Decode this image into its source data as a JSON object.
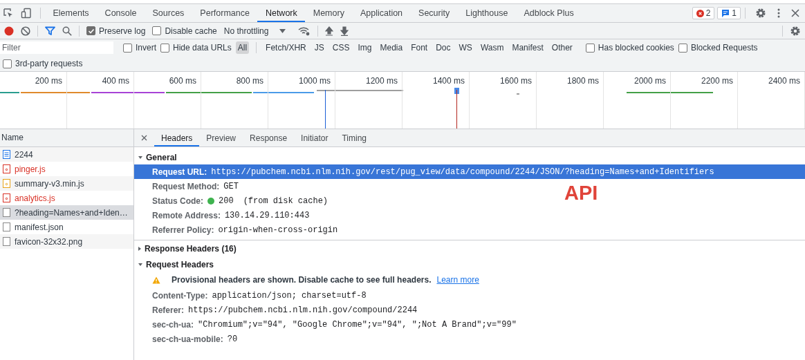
{
  "tabs": [
    {
      "label": "Elements",
      "selected": false
    },
    {
      "label": "Console",
      "selected": false
    },
    {
      "label": "Sources",
      "selected": false
    },
    {
      "label": "Performance",
      "selected": false
    },
    {
      "label": "Network",
      "selected": true
    },
    {
      "label": "Memory",
      "selected": false
    },
    {
      "label": "Application",
      "selected": false
    },
    {
      "label": "Security",
      "selected": false
    },
    {
      "label": "Lighthouse",
      "selected": false
    },
    {
      "label": "Adblock Plus",
      "selected": false
    }
  ],
  "badges": {
    "errors": "2",
    "messages": "1"
  },
  "toolbar": {
    "recording": true,
    "preserve_log": {
      "label": "Preserve log",
      "checked": true
    },
    "disable_cache": {
      "label": "Disable cache",
      "checked": false
    },
    "throttling": "No throttling"
  },
  "filter_bar": {
    "placeholder": "Filter",
    "options": [
      {
        "label": "Invert",
        "checked": false
      },
      {
        "label": "Hide data URLs",
        "checked": false
      }
    ],
    "types": [
      {
        "label": "All",
        "selected": true
      },
      {
        "label": "Fetch/XHR",
        "selected": false
      },
      {
        "label": "JS",
        "selected": false
      },
      {
        "label": "CSS",
        "selected": false
      },
      {
        "label": "Img",
        "selected": false
      },
      {
        "label": "Media",
        "selected": false
      },
      {
        "label": "Font",
        "selected": false
      },
      {
        "label": "Doc",
        "selected": false
      },
      {
        "label": "WS",
        "selected": false
      },
      {
        "label": "Wasm",
        "selected": false
      },
      {
        "label": "Manifest",
        "selected": false
      },
      {
        "label": "Other",
        "selected": false
      }
    ],
    "blocked": [
      {
        "label": "Has blocked cookies",
        "checked": false
      },
      {
        "label": "Blocked Requests",
        "checked": false
      }
    ],
    "third_party": {
      "label": "3rd-party requests",
      "checked": false
    }
  },
  "timeline": {
    "ticks": [
      "200 ms",
      "400 ms",
      "600 ms",
      "800 ms",
      "1000 ms",
      "1200 ms",
      "1400 ms",
      "1600 ms",
      "1800 ms",
      "2000 ms",
      "2200 ms",
      "2400 ms"
    ]
  },
  "requests": {
    "column": "Name",
    "rows": [
      {
        "name": "2244",
        "kind": "doc",
        "failed": false,
        "selected": false
      },
      {
        "name": "pinger.js",
        "kind": "script",
        "failed": true,
        "selected": false
      },
      {
        "name": "summary-v3.min.js",
        "kind": "script",
        "failed": false,
        "selected": false
      },
      {
        "name": "analytics.js",
        "kind": "script",
        "failed": true,
        "selected": false
      },
      {
        "name": "?heading=Names+and+Iden…",
        "kind": "other",
        "failed": false,
        "selected": true
      },
      {
        "name": "manifest.json",
        "kind": "other",
        "failed": false,
        "selected": false
      },
      {
        "name": "favicon-32x32.png",
        "kind": "other",
        "failed": false,
        "selected": false
      }
    ]
  },
  "detail_tabs": [
    {
      "label": "Headers",
      "selected": true
    },
    {
      "label": "Preview",
      "selected": false
    },
    {
      "label": "Response",
      "selected": false
    },
    {
      "label": "Initiator",
      "selected": false
    },
    {
      "label": "Timing",
      "selected": false
    }
  ],
  "general": {
    "title": "General",
    "expanded": true,
    "fields": [
      {
        "key": "Request URL:",
        "value": "https://pubchem.ncbi.nlm.nih.gov/rest/pug_view/data/compound/2244/JSON/?heading=Names+and+Identifiers",
        "selected": true
      },
      {
        "key": "Request Method:",
        "value": "GET",
        "selected": false
      },
      {
        "key": "Status Code:",
        "value": "200",
        "note": "(from disk cache)",
        "kind": "status",
        "selected": false
      },
      {
        "key": "Remote Address:",
        "value": "130.14.29.110:443",
        "selected": false
      },
      {
        "key": "Referrer Policy:",
        "value": "origin-when-cross-origin",
        "selected": false
      }
    ]
  },
  "annotation": "API",
  "response_headers": {
    "title": "Response Headers (16)",
    "expanded": false
  },
  "request_headers": {
    "title": "Request Headers",
    "expanded": true,
    "warning": "Provisional headers are shown. Disable cache to see full headers.",
    "link": "Learn more",
    "fields": [
      {
        "key": "Content-Type:",
        "value": "application/json; charset=utf-8"
      },
      {
        "key": "Referer:",
        "value": "https://pubchem.ncbi.nlm.nih.gov/compound/2244"
      },
      {
        "key": "sec-ch-ua:",
        "value": "\"Chromium\";v=\"94\", \"Google Chrome\";v=\"94\", \";Not A Brand\";v=\"99\""
      },
      {
        "key": "sec-ch-ua-mobile:",
        "value": "?0"
      }
    ]
  }
}
